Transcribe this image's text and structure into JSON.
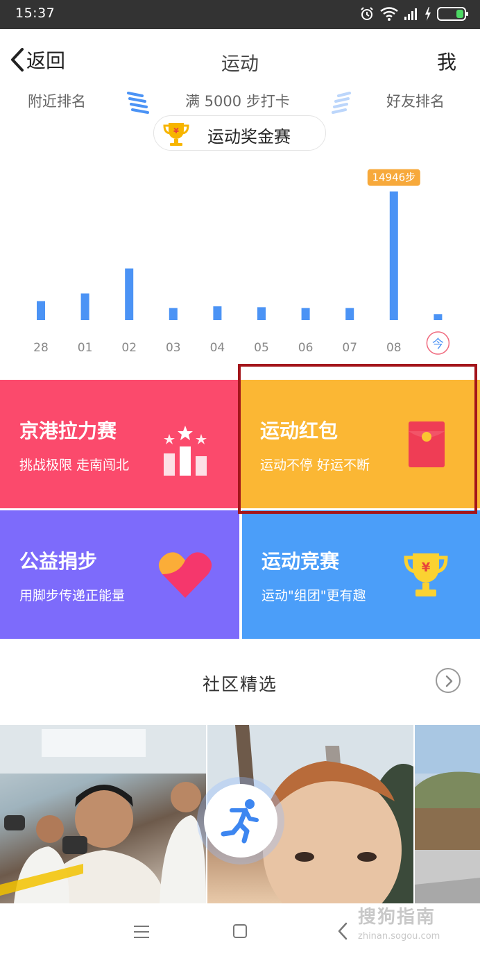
{
  "status": {
    "time": "15:37"
  },
  "header": {
    "back_label": "返回",
    "title": "运动",
    "me_label": "我"
  },
  "links": {
    "nearby": "附近排名",
    "checkin": "满 5000 步打卡",
    "friends": "好友排名"
  },
  "prize": {
    "label": "运动奖金赛"
  },
  "chart_data": {
    "type": "bar",
    "categories": [
      "28",
      "01",
      "02",
      "03",
      "04",
      "05",
      "06",
      "07",
      "08",
      "今"
    ],
    "values": [
      2200,
      3100,
      6000,
      1400,
      1600,
      1500,
      1400,
      1400,
      14946,
      700
    ],
    "ylim": [
      0,
      15000
    ],
    "highlight_index": 8,
    "highlight_label": "14946步",
    "bar_color": "#4b93f5",
    "label_color": "#f7a93b",
    "today_color": "#f06a7e"
  },
  "cards": [
    {
      "title": "京港拉力赛",
      "subtitle": "挑战极限 走南闯北",
      "color": "#fb4a6c"
    },
    {
      "title": "运动红包",
      "subtitle": "运动不停 好运不断",
      "color": "#fbb734"
    },
    {
      "title": "公益捐步",
      "subtitle": "用脚步传递正能量",
      "color": "#7d6bfb"
    },
    {
      "title": "运动竞赛",
      "subtitle": "运动\"组团\"更有趣",
      "color": "#4b9ef9"
    }
  ],
  "community": {
    "title": "社区精选"
  },
  "watermark": {
    "name": "搜狗指南",
    "url": "zhinan.sogou.com"
  }
}
